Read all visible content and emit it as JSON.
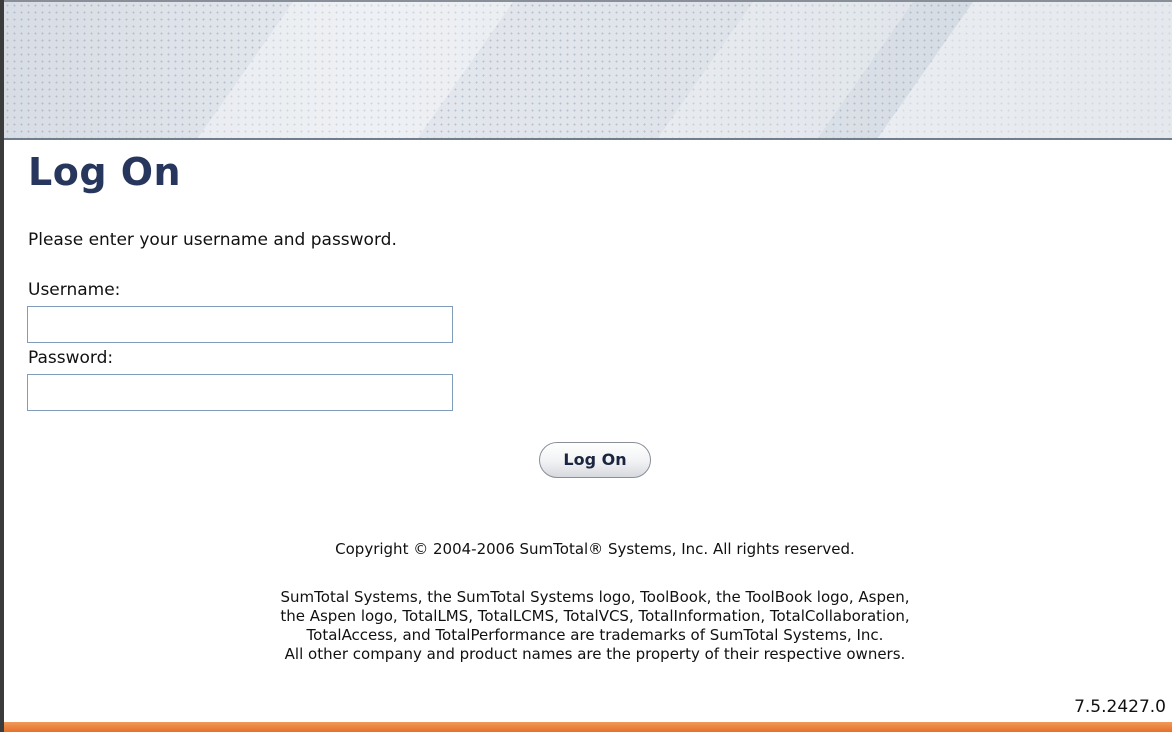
{
  "page": {
    "title": "Log On",
    "instructions": "Please enter your username and password."
  },
  "form": {
    "username_label": "Username:",
    "username_value": "",
    "password_label": "Password:",
    "password_value": "",
    "submit_label": "Log On"
  },
  "footer": {
    "copyright": "Copyright © 2004-2006 SumTotal® Systems, Inc. All rights reserved.",
    "trademarks": [
      "SumTotal Systems, the SumTotal Systems logo, ToolBook, the ToolBook logo, Aspen,",
      "the Aspen logo, TotalLMS, TotalLCMS, TotalVCS, TotalInformation, TotalCollaboration,",
      "TotalAccess, and TotalPerformance are trademarks of SumTotal Systems, Inc.",
      "All other company and product names are the property of their respective owners."
    ],
    "version": "7.5.2427.0"
  },
  "colors": {
    "title": "#26365c",
    "footer_bar": "#e5702a",
    "banner": "#dfe4ea"
  }
}
